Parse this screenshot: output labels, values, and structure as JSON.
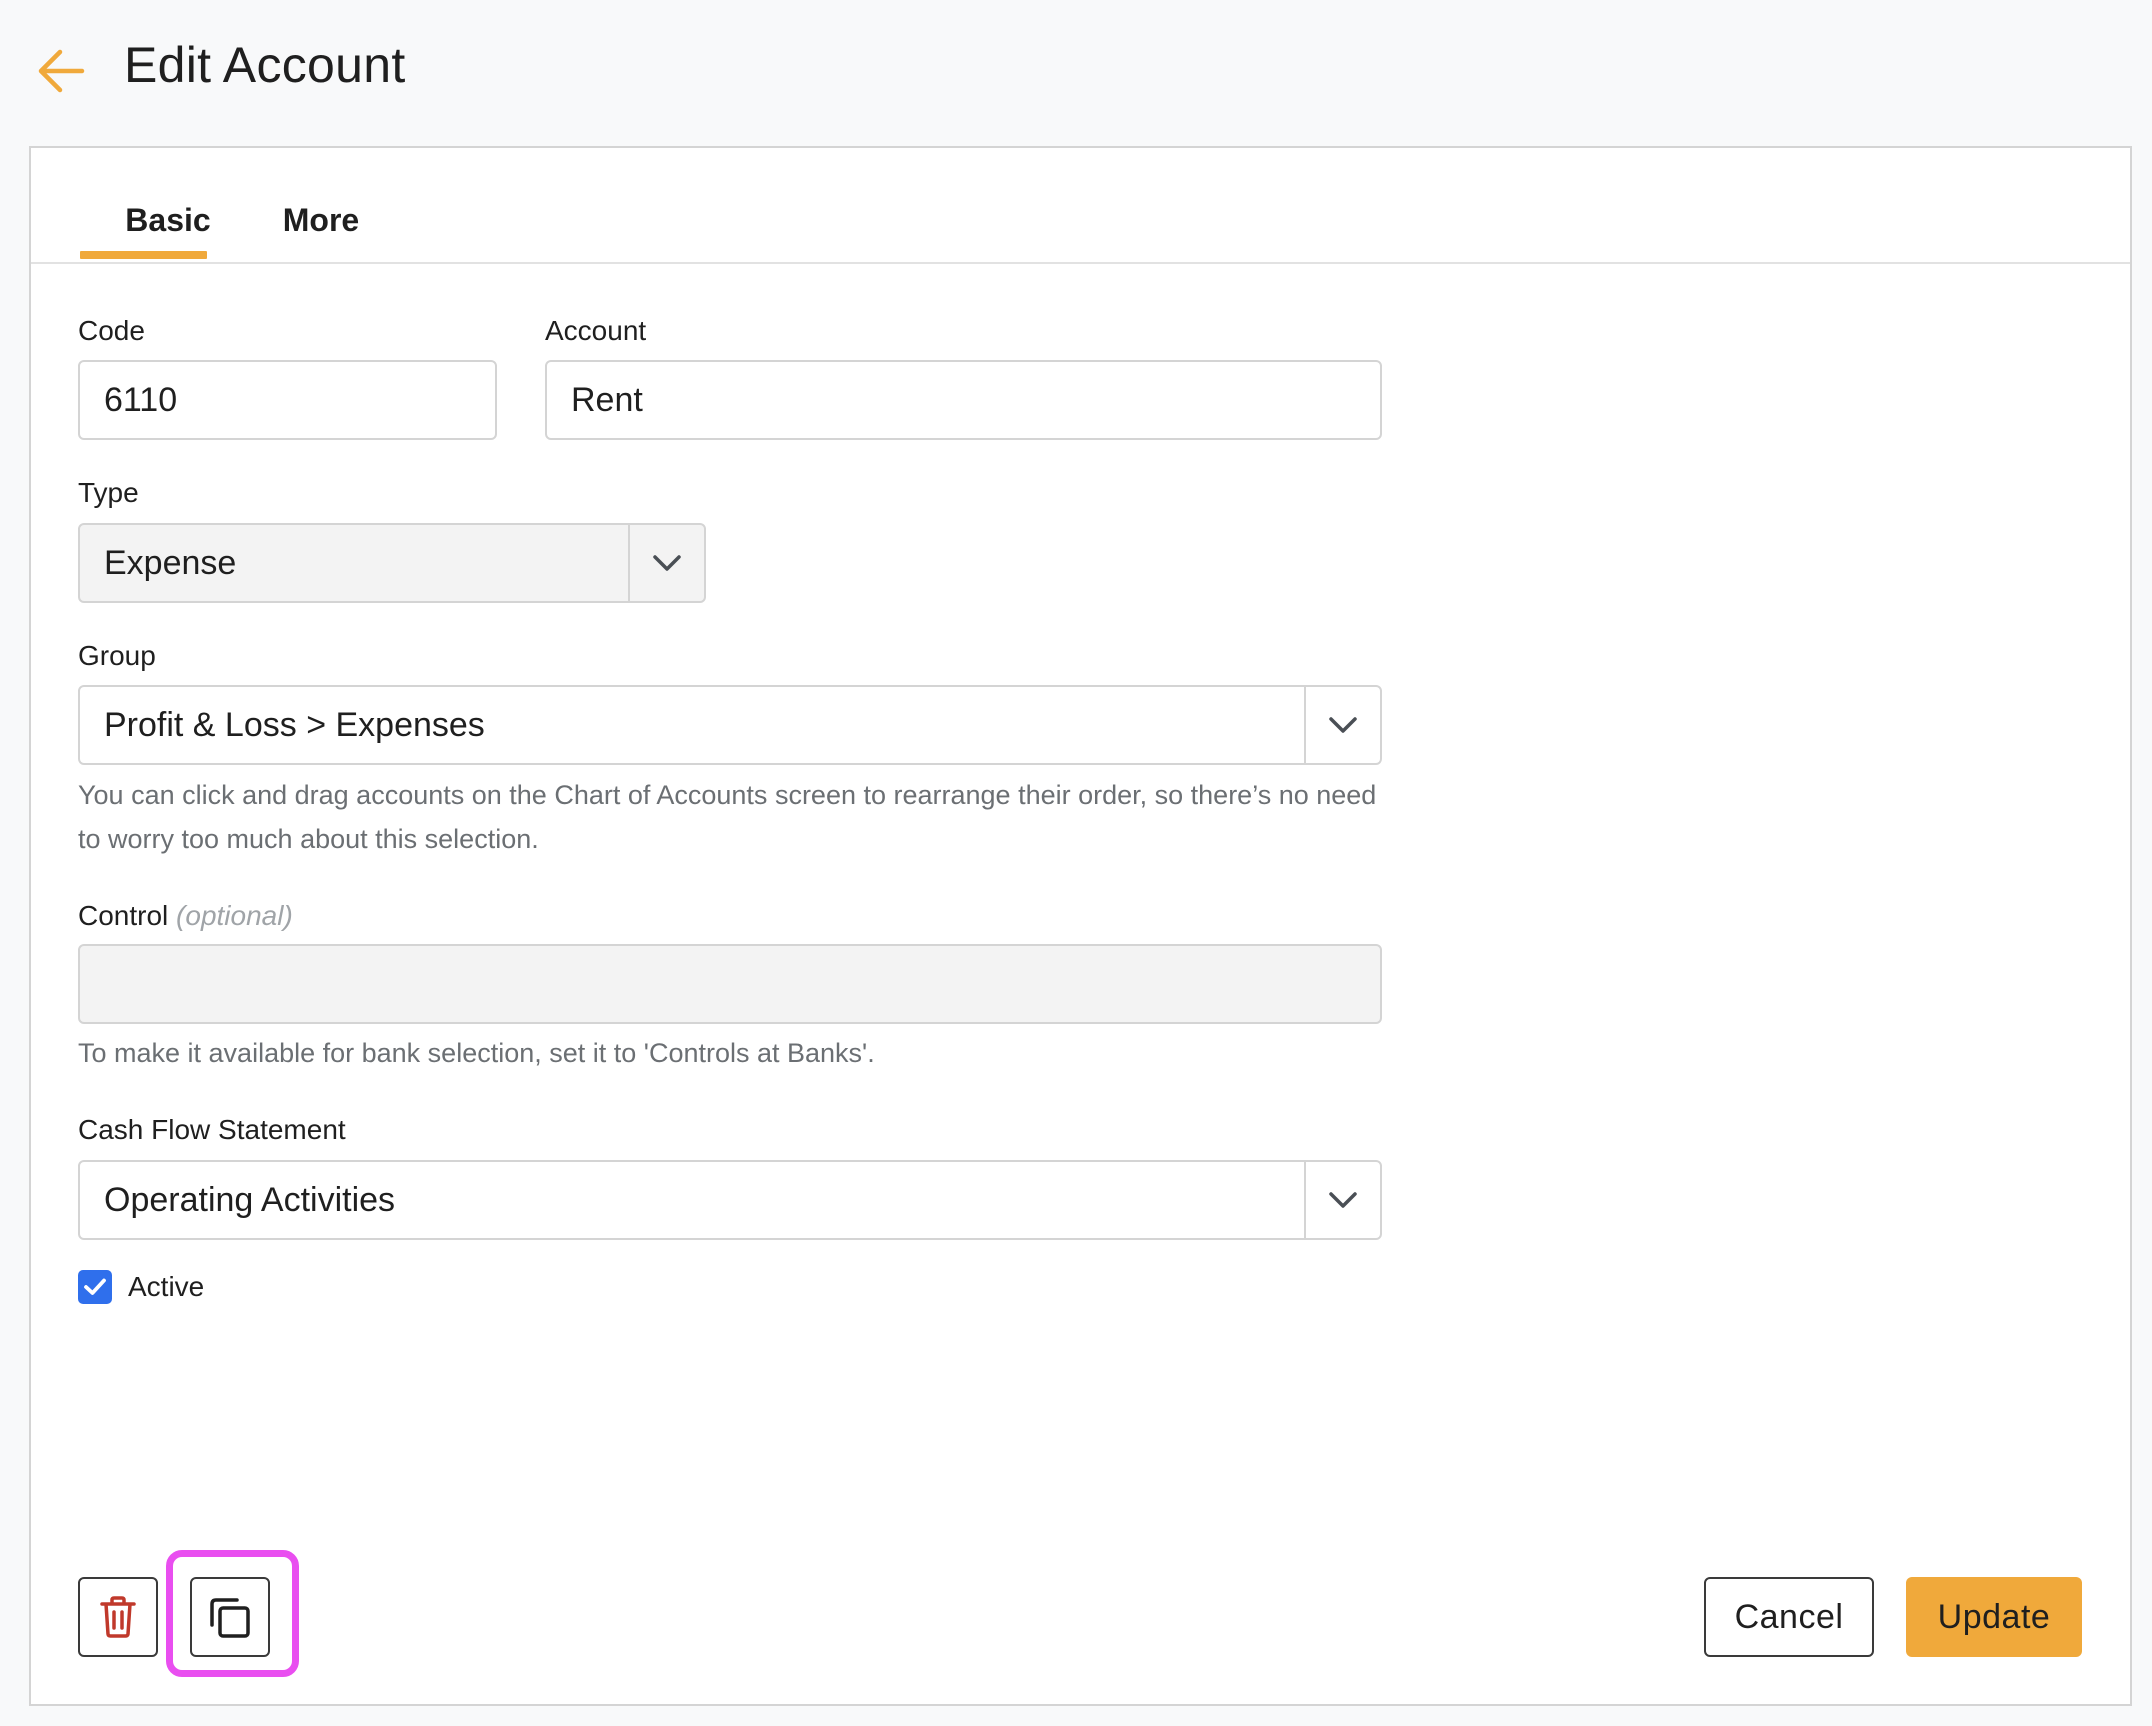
{
  "page": {
    "title": "Edit Account"
  },
  "tabs": [
    {
      "label": "Basic",
      "active": true
    },
    {
      "label": "More",
      "active": false
    }
  ],
  "form": {
    "code": {
      "label": "Code",
      "value": "6110"
    },
    "account": {
      "label": "Account",
      "value": "Rent"
    },
    "type": {
      "label": "Type",
      "value": "Expense"
    },
    "group": {
      "label": "Group",
      "value": "Profit & Loss > Expenses",
      "help_line1": "You can click and drag accounts on the Chart of Accounts screen to rearrange their order, so there’s no need",
      "help_line2": "to worry too much about this selection."
    },
    "control": {
      "label": "Control",
      "optional": "(optional)",
      "value": "",
      "help": "To make it available for bank selection, set it to 'Controls at Banks'."
    },
    "cash_flow": {
      "label": "Cash Flow Statement",
      "value": "Operating Activities"
    },
    "active": {
      "label": "Active",
      "checked": true
    }
  },
  "actions": {
    "cancel": "Cancel",
    "update": "Update"
  },
  "icons": {
    "back": "arrow-left-icon",
    "caret": "chevron-down-icon",
    "delete": "trash-icon",
    "duplicate": "copy-icon",
    "check": "checkmark-icon"
  },
  "colors": {
    "accent": "#f0a93b",
    "delete": "#c0392b",
    "checkbox": "#2f6fec",
    "highlight": "#e94ef0"
  }
}
